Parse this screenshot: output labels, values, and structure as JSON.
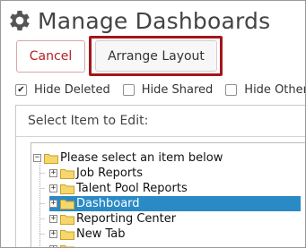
{
  "header": {
    "title": "Manage Dashboards",
    "icon": "gear-icon"
  },
  "buttons": {
    "cancel_label": "Cancel",
    "arrange_label": "Arrange Layout"
  },
  "filters": [
    {
      "label": "Hide Deleted",
      "checked": true
    },
    {
      "label": "Hide Shared",
      "checked": false
    },
    {
      "label": "Hide Others'",
      "checked": false
    }
  ],
  "panel": {
    "title": "Select Item to Edit:"
  },
  "tree": {
    "root_label": "Please select an item below",
    "items": [
      {
        "label": "Job Reports",
        "selected": false
      },
      {
        "label": "Talent Pool Reports",
        "selected": false
      },
      {
        "label": "Dashboard",
        "selected": true
      },
      {
        "label": "Reporting Center",
        "selected": false
      },
      {
        "label": "New Tab",
        "selected": false
      }
    ]
  },
  "colors": {
    "accent_red": "#a4161a",
    "cancel_text": "#b22222",
    "selection": "#2a8ac5",
    "folder": "#f5d76e"
  }
}
